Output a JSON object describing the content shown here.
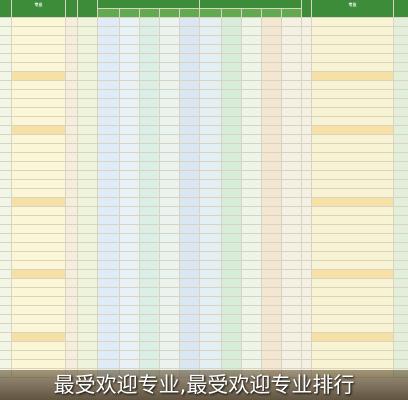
{
  "header": {
    "col_major": "专业",
    "col_code": "",
    "col_plan": "",
    "group_left": "",
    "group_right": "",
    "col_a": "",
    "col_b": "",
    "col_c": "",
    "col_d": "",
    "col_e": "",
    "col_f": "",
    "col_g": "",
    "col_h": "",
    "col_i": "",
    "col_tag": "",
    "col_major2": "专业",
    "col_r1": "",
    "col_r2": ""
  },
  "rows": [
    {
      "idx": "",
      "name": "",
      "code": "",
      "a": "",
      "b": "",
      "c": "",
      "d": "",
      "e": "",
      "f": "",
      "g": "",
      "h": "",
      "i": "",
      "tag": "",
      "name2": "",
      "r1": "",
      "r2": ""
    },
    {
      "idx": "",
      "name": "",
      "code": "",
      "a": "",
      "b": "",
      "c": "",
      "d": "",
      "e": "",
      "f": "",
      "g": "",
      "h": "",
      "i": "",
      "tag": "",
      "name2": "",
      "r1": "",
      "r2": ""
    },
    {
      "idx": "",
      "name": "",
      "code": "",
      "a": "",
      "b": "",
      "c": "",
      "d": "",
      "e": "",
      "f": "",
      "g": "",
      "h": "",
      "i": "",
      "tag": "",
      "name2": "",
      "r1": "",
      "r2": ""
    },
    {
      "idx": "",
      "name": "",
      "code": "",
      "a": "",
      "b": "",
      "c": "",
      "d": "",
      "e": "",
      "f": "",
      "g": "",
      "h": "",
      "i": "",
      "tag": "",
      "name2": "",
      "r1": "",
      "r2": ""
    },
    {
      "idx": "",
      "name": "",
      "code": "",
      "a": "",
      "b": "",
      "c": "",
      "d": "",
      "e": "",
      "f": "",
      "g": "",
      "h": "",
      "i": "",
      "tag": "",
      "name2": "",
      "r1": "",
      "r2": ""
    },
    {
      "idx": "",
      "name": "",
      "code": "",
      "a": "",
      "b": "",
      "c": "",
      "d": "",
      "e": "",
      "f": "",
      "g": "",
      "h": "",
      "i": "",
      "tag": "",
      "name2": "",
      "r1": "",
      "r2": ""
    },
    {
      "idx": "",
      "name": "",
      "code": "",
      "a": "",
      "b": "",
      "c": "",
      "d": "",
      "e": "",
      "f": "",
      "g": "",
      "h": "",
      "i": "",
      "tag": "",
      "name2": "",
      "r1": "",
      "r2": ""
    },
    {
      "idx": "",
      "name": "",
      "code": "",
      "a": "",
      "b": "",
      "c": "",
      "d": "",
      "e": "",
      "f": "",
      "g": "",
      "h": "",
      "i": "",
      "tag": "",
      "name2": "",
      "r1": "",
      "r2": ""
    },
    {
      "idx": "",
      "name": "",
      "code": "",
      "a": "",
      "b": "",
      "c": "",
      "d": "",
      "e": "",
      "f": "",
      "g": "",
      "h": "",
      "i": "",
      "tag": "",
      "name2": "",
      "r1": "",
      "r2": ""
    },
    {
      "idx": "",
      "name": "",
      "code": "",
      "a": "",
      "b": "",
      "c": "",
      "d": "",
      "e": "",
      "f": "",
      "g": "",
      "h": "",
      "i": "",
      "tag": "",
      "name2": "",
      "r1": "",
      "r2": ""
    },
    {
      "idx": "",
      "name": "",
      "code": "",
      "a": "",
      "b": "",
      "c": "",
      "d": "",
      "e": "",
      "f": "",
      "g": "",
      "h": "",
      "i": "",
      "tag": "",
      "name2": "",
      "r1": "",
      "r2": ""
    },
    {
      "idx": "",
      "name": "",
      "code": "",
      "a": "",
      "b": "",
      "c": "",
      "d": "",
      "e": "",
      "f": "",
      "g": "",
      "h": "",
      "i": "",
      "tag": "",
      "name2": "",
      "r1": "",
      "r2": ""
    },
    {
      "idx": "",
      "name": "",
      "code": "",
      "a": "",
      "b": "",
      "c": "",
      "d": "",
      "e": "",
      "f": "",
      "g": "",
      "h": "",
      "i": "",
      "tag": "",
      "name2": "",
      "r1": "",
      "r2": ""
    },
    {
      "idx": "",
      "name": "",
      "code": "",
      "a": "",
      "b": "",
      "c": "",
      "d": "",
      "e": "",
      "f": "",
      "g": "",
      "h": "",
      "i": "",
      "tag": "",
      "name2": "",
      "r1": "",
      "r2": ""
    },
    {
      "idx": "",
      "name": "",
      "code": "",
      "a": "",
      "b": "",
      "c": "",
      "d": "",
      "e": "",
      "f": "",
      "g": "",
      "h": "",
      "i": "",
      "tag": "",
      "name2": "",
      "r1": "",
      "r2": ""
    },
    {
      "idx": "",
      "name": "",
      "code": "",
      "a": "",
      "b": "",
      "c": "",
      "d": "",
      "e": "",
      "f": "",
      "g": "",
      "h": "",
      "i": "",
      "tag": "",
      "name2": "",
      "r1": "",
      "r2": ""
    },
    {
      "idx": "",
      "name": "",
      "code": "",
      "a": "",
      "b": "",
      "c": "",
      "d": "",
      "e": "",
      "f": "",
      "g": "",
      "h": "",
      "i": "",
      "tag": "",
      "name2": "",
      "r1": "",
      "r2": ""
    },
    {
      "idx": "",
      "name": "",
      "code": "",
      "a": "",
      "b": "",
      "c": "",
      "d": "",
      "e": "",
      "f": "",
      "g": "",
      "h": "",
      "i": "",
      "tag": "",
      "name2": "",
      "r1": "",
      "r2": ""
    },
    {
      "idx": "",
      "name": "",
      "code": "",
      "a": "",
      "b": "",
      "c": "",
      "d": "",
      "e": "",
      "f": "",
      "g": "",
      "h": "",
      "i": "",
      "tag": "",
      "name2": "",
      "r1": "",
      "r2": ""
    },
    {
      "idx": "",
      "name": "",
      "code": "",
      "a": "",
      "b": "",
      "c": "",
      "d": "",
      "e": "",
      "f": "",
      "g": "",
      "h": "",
      "i": "",
      "tag": "",
      "name2": "",
      "r1": "",
      "r2": ""
    },
    {
      "idx": "",
      "name": "",
      "code": "",
      "a": "",
      "b": "",
      "c": "",
      "d": "",
      "e": "",
      "f": "",
      "g": "",
      "h": "",
      "i": "",
      "tag": "",
      "name2": "",
      "r1": "",
      "r2": ""
    },
    {
      "idx": "",
      "name": "",
      "code": "",
      "a": "",
      "b": "",
      "c": "",
      "d": "",
      "e": "",
      "f": "",
      "g": "",
      "h": "",
      "i": "",
      "tag": "",
      "name2": "",
      "r1": "",
      "r2": ""
    },
    {
      "idx": "",
      "name": "",
      "code": "",
      "a": "",
      "b": "",
      "c": "",
      "d": "",
      "e": "",
      "f": "",
      "g": "",
      "h": "",
      "i": "",
      "tag": "",
      "name2": "",
      "r1": "",
      "r2": ""
    },
    {
      "idx": "",
      "name": "",
      "code": "",
      "a": "",
      "b": "",
      "c": "",
      "d": "",
      "e": "",
      "f": "",
      "g": "",
      "h": "",
      "i": "",
      "tag": "",
      "name2": "",
      "r1": "",
      "r2": ""
    },
    {
      "idx": "",
      "name": "",
      "code": "",
      "a": "",
      "b": "",
      "c": "",
      "d": "",
      "e": "",
      "f": "",
      "g": "",
      "h": "",
      "i": "",
      "tag": "",
      "name2": "",
      "r1": "",
      "r2": ""
    },
    {
      "idx": "",
      "name": "",
      "code": "",
      "a": "",
      "b": "",
      "c": "",
      "d": "",
      "e": "",
      "f": "",
      "g": "",
      "h": "",
      "i": "",
      "tag": "",
      "name2": "",
      "r1": "",
      "r2": ""
    },
    {
      "idx": "",
      "name": "",
      "code": "",
      "a": "",
      "b": "",
      "c": "",
      "d": "",
      "e": "",
      "f": "",
      "g": "",
      "h": "",
      "i": "",
      "tag": "",
      "name2": "",
      "r1": "",
      "r2": ""
    },
    {
      "idx": "",
      "name": "",
      "code": "",
      "a": "",
      "b": "",
      "c": "",
      "d": "",
      "e": "",
      "f": "",
      "g": "",
      "h": "",
      "i": "",
      "tag": "",
      "name2": "",
      "r1": "",
      "r2": ""
    },
    {
      "idx": "",
      "name": "",
      "code": "",
      "a": "",
      "b": "",
      "c": "",
      "d": "",
      "e": "",
      "f": "",
      "g": "",
      "h": "",
      "i": "",
      "tag": "",
      "name2": "",
      "r1": "",
      "r2": ""
    },
    {
      "idx": "",
      "name": "",
      "code": "",
      "a": "",
      "b": "",
      "c": "",
      "d": "",
      "e": "",
      "f": "",
      "g": "",
      "h": "",
      "i": "",
      "tag": "",
      "name2": "",
      "r1": "",
      "r2": ""
    },
    {
      "idx": "",
      "name": "",
      "code": "",
      "a": "",
      "b": "",
      "c": "",
      "d": "",
      "e": "",
      "f": "",
      "g": "",
      "h": "",
      "i": "",
      "tag": "",
      "name2": "",
      "r1": "",
      "r2": ""
    },
    {
      "idx": "",
      "name": "",
      "code": "",
      "a": "",
      "b": "",
      "c": "",
      "d": "",
      "e": "",
      "f": "",
      "g": "",
      "h": "",
      "i": "",
      "tag": "",
      "name2": "",
      "r1": "",
      "r2": ""
    },
    {
      "idx": "",
      "name": "",
      "code": "",
      "a": "",
      "b": "",
      "c": "",
      "d": "",
      "e": "",
      "f": "",
      "g": "",
      "h": "",
      "i": "",
      "tag": "",
      "name2": "",
      "r1": "",
      "r2": ""
    },
    {
      "idx": "",
      "name": "",
      "code": "",
      "a": "",
      "b": "",
      "c": "",
      "d": "",
      "e": "",
      "f": "",
      "g": "",
      "h": "",
      "i": "",
      "tag": "",
      "name2": "",
      "r1": "",
      "r2": ""
    },
    {
      "idx": "",
      "name": "",
      "code": "",
      "a": "",
      "b": "",
      "c": "",
      "d": "",
      "e": "",
      "f": "",
      "g": "",
      "h": "",
      "i": "",
      "tag": "",
      "name2": "",
      "r1": "",
      "r2": ""
    },
    {
      "idx": "",
      "name": "",
      "code": "",
      "a": "",
      "b": "",
      "c": "",
      "d": "",
      "e": "",
      "f": "",
      "g": "",
      "h": "",
      "i": "",
      "tag": "",
      "name2": "",
      "r1": "",
      "r2": ""
    },
    {
      "idx": "",
      "name": "",
      "code": "",
      "a": "",
      "b": "",
      "c": "",
      "d": "",
      "e": "",
      "f": "",
      "g": "",
      "h": "",
      "i": "",
      "tag": "",
      "name2": "",
      "r1": "",
      "r2": ""
    },
    {
      "idx": "",
      "name": "",
      "code": "",
      "a": "",
      "b": "",
      "c": "",
      "d": "",
      "e": "",
      "f": "",
      "g": "",
      "h": "",
      "i": "",
      "tag": "",
      "name2": "",
      "r1": "",
      "r2": ""
    },
    {
      "idx": "",
      "name": "",
      "code": "",
      "a": "",
      "b": "",
      "c": "",
      "d": "",
      "e": "",
      "f": "",
      "g": "",
      "h": "",
      "i": "",
      "tag": "",
      "name2": "",
      "r1": "",
      "r2": ""
    },
    {
      "idx": "",
      "name": "",
      "code": "",
      "a": "",
      "b": "",
      "c": "",
      "d": "",
      "e": "",
      "f": "",
      "g": "",
      "h": "",
      "i": "",
      "tag": "",
      "name2": "",
      "r1": "",
      "r2": ""
    }
  ],
  "highlight_rows": [
    6,
    12,
    20,
    28,
    35
  ],
  "red_rows": [
    13,
    14,
    15
  ],
  "caption": "最受欢迎专业,最受欢迎专业排行",
  "colors": {
    "header_green": "#3c8c3a",
    "caption_text": "#ffffff",
    "name_blue": "#3a5fa8",
    "name_red": "#c2392b"
  }
}
